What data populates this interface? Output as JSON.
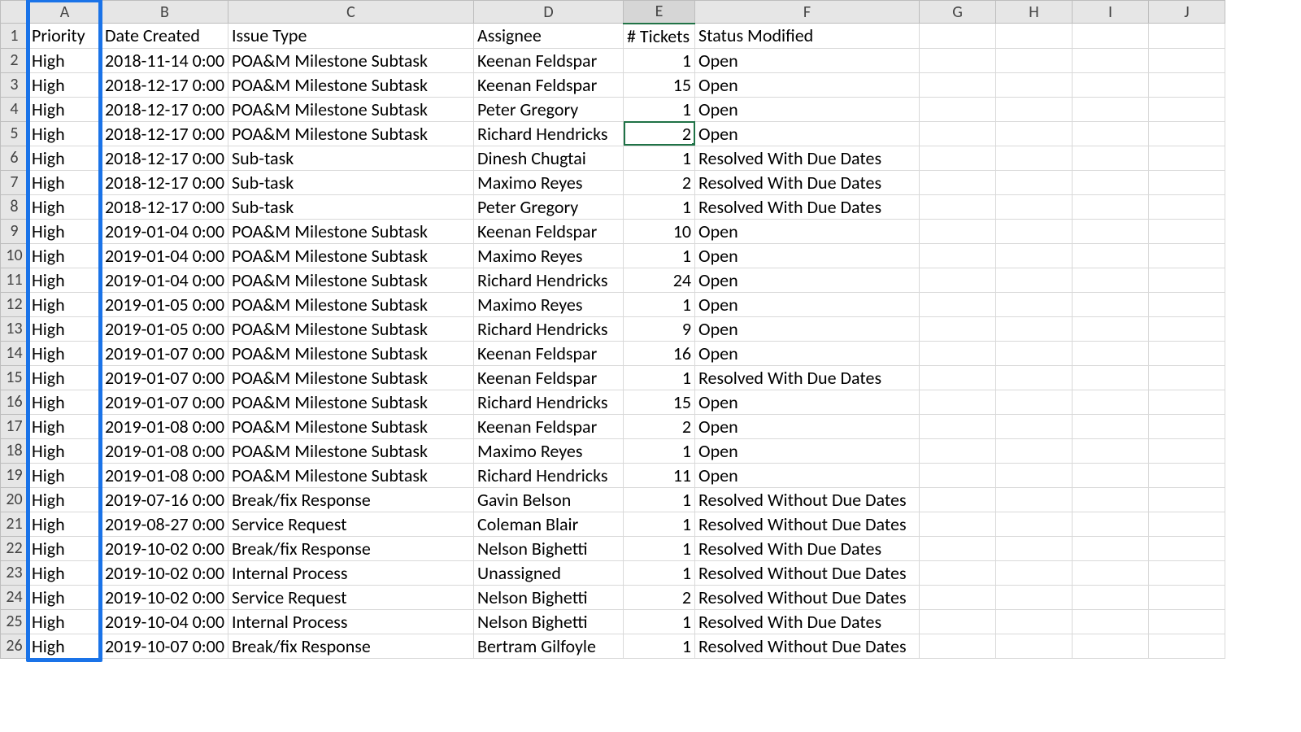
{
  "columns": {
    "letters": [
      "A",
      "B",
      "C",
      "D",
      "E",
      "F",
      "G",
      "H",
      "I",
      "J"
    ],
    "widths": [
      90,
      148,
      302,
      184,
      88,
      276,
      94,
      94,
      94,
      94
    ],
    "selected": "E"
  },
  "rowNumbers": [
    1,
    2,
    3,
    4,
    5,
    6,
    7,
    8,
    9,
    10,
    11,
    12,
    13,
    14,
    15,
    16,
    17,
    18,
    19,
    20,
    21,
    22,
    23,
    24,
    25,
    26
  ],
  "headers": {
    "A": "Priority",
    "B": "Date Created",
    "C": "Issue Type",
    "D": "Assignee",
    "E": "# Tickets",
    "F": "Status Modified"
  },
  "rows": [
    {
      "A": "High",
      "B": "2018-11-14 0:00",
      "C": "POA&M Milestone Subtask",
      "D": "Keenan Feldspar",
      "E": 1,
      "F": "Open"
    },
    {
      "A": "High",
      "B": "2018-12-17 0:00",
      "C": "POA&M Milestone Subtask",
      "D": "Keenan Feldspar",
      "E": 15,
      "F": "Open"
    },
    {
      "A": "High",
      "B": "2018-12-17 0:00",
      "C": "POA&M Milestone Subtask",
      "D": "Peter Gregory",
      "E": 1,
      "F": "Open"
    },
    {
      "A": "High",
      "B": "2018-12-17 0:00",
      "C": "POA&M Milestone Subtask",
      "D": "Richard Hendricks",
      "E": 2,
      "F": "Open"
    },
    {
      "A": "High",
      "B": "2018-12-17 0:00",
      "C": "Sub-task",
      "D": "Dinesh Chugtai",
      "E": 1,
      "F": "Resolved With Due Dates"
    },
    {
      "A": "High",
      "B": "2018-12-17 0:00",
      "C": "Sub-task",
      "D": "Maximo Reyes",
      "E": 2,
      "F": "Resolved With Due Dates"
    },
    {
      "A": "High",
      "B": "2018-12-17 0:00",
      "C": "Sub-task",
      "D": "Peter Gregory",
      "E": 1,
      "F": "Resolved With Due Dates"
    },
    {
      "A": "High",
      "B": "2019-01-04 0:00",
      "C": "POA&M Milestone Subtask",
      "D": "Keenan Feldspar",
      "E": 10,
      "F": "Open"
    },
    {
      "A": "High",
      "B": "2019-01-04 0:00",
      "C": "POA&M Milestone Subtask",
      "D": "Maximo Reyes",
      "E": 1,
      "F": "Open"
    },
    {
      "A": "High",
      "B": "2019-01-04 0:00",
      "C": "POA&M Milestone Subtask",
      "D": "Richard Hendricks",
      "E": 24,
      "F": "Open"
    },
    {
      "A": "High",
      "B": "2019-01-05 0:00",
      "C": "POA&M Milestone Subtask",
      "D": "Maximo Reyes",
      "E": 1,
      "F": "Open"
    },
    {
      "A": "High",
      "B": "2019-01-05 0:00",
      "C": "POA&M Milestone Subtask",
      "D": "Richard Hendricks",
      "E": 9,
      "F": "Open"
    },
    {
      "A": "High",
      "B": "2019-01-07 0:00",
      "C": "POA&M Milestone Subtask",
      "D": "Keenan Feldspar",
      "E": 16,
      "F": "Open"
    },
    {
      "A": "High",
      "B": "2019-01-07 0:00",
      "C": "POA&M Milestone Subtask",
      "D": "Keenan Feldspar",
      "E": 1,
      "F": "Resolved With Due Dates"
    },
    {
      "A": "High",
      "B": "2019-01-07 0:00",
      "C": "POA&M Milestone Subtask",
      "D": "Richard Hendricks",
      "E": 15,
      "F": "Open"
    },
    {
      "A": "High",
      "B": "2019-01-08 0:00",
      "C": "POA&M Milestone Subtask",
      "D": "Keenan Feldspar",
      "E": 2,
      "F": "Open"
    },
    {
      "A": "High",
      "B": "2019-01-08 0:00",
      "C": "POA&M Milestone Subtask",
      "D": "Maximo Reyes",
      "E": 1,
      "F": "Open"
    },
    {
      "A": "High",
      "B": "2019-01-08 0:00",
      "C": "POA&M Milestone Subtask",
      "D": "Richard Hendricks",
      "E": 11,
      "F": "Open"
    },
    {
      "A": "High",
      "B": "2019-07-16 0:00",
      "C": "Break/fix Response",
      "D": "Gavin Belson",
      "E": 1,
      "F": "Resolved Without Due Dates"
    },
    {
      "A": "High",
      "B": "2019-08-27 0:00",
      "C": "Service Request",
      "D": "Coleman Blair",
      "E": 1,
      "F": "Resolved Without Due Dates"
    },
    {
      "A": "High",
      "B": "2019-10-02 0:00",
      "C": "Break/fix Response",
      "D": "Nelson Bighetti",
      "E": 1,
      "F": "Resolved With Due Dates"
    },
    {
      "A": "High",
      "B": "2019-10-02 0:00",
      "C": "Internal Process",
      "D": "Unassigned",
      "E": 1,
      "F": "Resolved Without Due Dates"
    },
    {
      "A": "High",
      "B": "2019-10-02 0:00",
      "C": "Service Request",
      "D": "Nelson Bighetti",
      "E": 2,
      "F": "Resolved Without Due Dates"
    },
    {
      "A": "High",
      "B": "2019-10-04 0:00",
      "C": "Internal Process",
      "D": "Nelson Bighetti",
      "E": 1,
      "F": "Resolved With Due Dates"
    },
    {
      "A": "High",
      "B": "2019-10-07 0:00",
      "C": "Break/fix Response",
      "D": "Bertram Gilfoyle",
      "E": 1,
      "F": "Resolved Without Due Dates"
    }
  ],
  "activeCell": {
    "row": 5,
    "col": "E"
  },
  "highlight": {
    "col": "A"
  }
}
